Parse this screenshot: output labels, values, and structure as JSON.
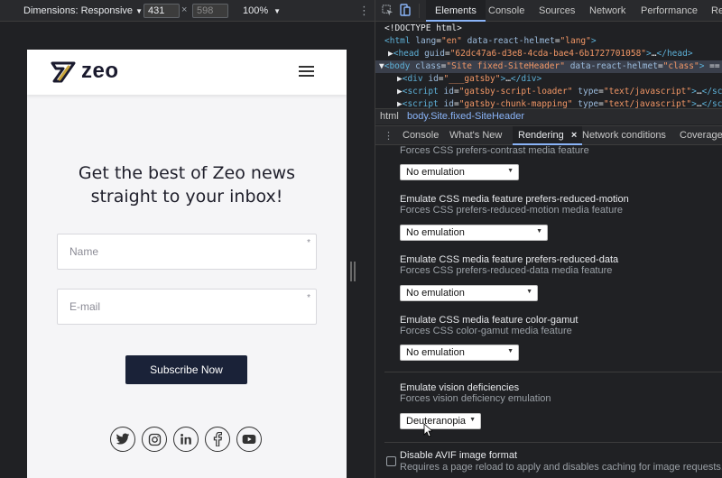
{
  "device_toolbar": {
    "dimensions_label": "Dimensions: Responsive",
    "width": "431",
    "height": "598",
    "times": "×",
    "zoom": "100%"
  },
  "phone": {
    "logo_text": "zeo",
    "headline": "Get the best of Zeo news straight to your inbox!",
    "name_placeholder": "Name",
    "email_placeholder": "E-mail",
    "required_mark": "*",
    "subscribe_label": "Subscribe Now",
    "social_icons": [
      "twitter-icon",
      "instagram-icon",
      "linkedin-icon",
      "facebook-icon",
      "youtube-icon"
    ]
  },
  "devtools": {
    "tabs": [
      "Elements",
      "Console",
      "Sources",
      "Network",
      "Performance",
      "Re"
    ],
    "active_tab": "Elements",
    "code_lines": [
      {
        "parts": [
          [
            "plain",
            "<!DOCTYPE html>"
          ]
        ]
      },
      {
        "parts": [
          [
            "tag",
            "<html "
          ],
          [
            "attr",
            "lang"
          ],
          [
            "plain",
            "="
          ],
          [
            "val",
            "\"en\""
          ],
          [
            "plain",
            " "
          ],
          [
            "attr",
            "data-react-helmet"
          ],
          [
            "plain",
            "="
          ],
          [
            "val",
            "\"lang\""
          ],
          [
            "tag",
            ">"
          ]
        ]
      },
      {
        "parts": [
          [
            "plain",
            "▶"
          ],
          [
            "tag",
            "<head "
          ],
          [
            "attr",
            "guid"
          ],
          [
            "plain",
            "="
          ],
          [
            "val",
            "\"62dc47a6-d3e8-4cda-bae4-6b1727701058\""
          ],
          [
            "tag",
            ">"
          ],
          [
            "plain",
            "…"
          ],
          [
            "tag",
            "</head>"
          ]
        ]
      },
      {
        "parts": [
          [
            "plain",
            "▼"
          ],
          [
            "tag",
            "<body "
          ],
          [
            "attr",
            "class"
          ],
          [
            "plain",
            "="
          ],
          [
            "val",
            "\"Site fixed-SiteHeader\""
          ],
          [
            "plain",
            " "
          ],
          [
            "attr",
            "data-react-helmet"
          ],
          [
            "plain",
            "="
          ],
          [
            "val",
            "\"class\""
          ],
          [
            "tag",
            ">"
          ],
          [
            "plain",
            " == $"
          ]
        ]
      },
      {
        "parts": [
          [
            "plain",
            "▶"
          ],
          [
            "tag",
            "<div "
          ],
          [
            "attr",
            "id"
          ],
          [
            "plain",
            "="
          ],
          [
            "val",
            "\"___gatsby\""
          ],
          [
            "tag",
            ">"
          ],
          [
            "plain",
            "…"
          ],
          [
            "tag",
            "</div>"
          ]
        ]
      },
      {
        "parts": [
          [
            "plain",
            "▶"
          ],
          [
            "tag",
            "<script "
          ],
          [
            "attr",
            "id"
          ],
          [
            "plain",
            "="
          ],
          [
            "val",
            "\"gatsby-script-loader\""
          ],
          [
            "plain",
            " "
          ],
          [
            "attr",
            "type"
          ],
          [
            "plain",
            "="
          ],
          [
            "val",
            "\"text/javascript\""
          ],
          [
            "tag",
            ">"
          ],
          [
            "plain",
            "…"
          ],
          [
            "tag",
            "</scrip"
          ]
        ]
      },
      {
        "parts": [
          [
            "plain",
            "▶"
          ],
          [
            "tag",
            "<script "
          ],
          [
            "attr",
            "id"
          ],
          [
            "plain",
            "="
          ],
          [
            "val",
            "\"gatsby-chunk-mapping\""
          ],
          [
            "plain",
            " "
          ],
          [
            "attr",
            "type"
          ],
          [
            "plain",
            "="
          ],
          [
            "val",
            "\"text/javascript\""
          ],
          [
            "tag",
            ">"
          ],
          [
            "plain",
            "…"
          ],
          [
            "tag",
            "</scrip"
          ]
        ]
      }
    ],
    "breadcrumb": [
      "html",
      "body.Site.fixed-SiteHeader"
    ],
    "drawer_tabs": [
      "Console",
      "What's New",
      "Rendering",
      "Network conditions",
      "Coverage"
    ],
    "active_drawer_tab": "Rendering",
    "close_glyph": "×",
    "rendering": {
      "contrast_desc": "Forces CSS prefers-contrast media feature",
      "contrast_value": "No emulation",
      "motion_title": "Emulate CSS media feature prefers-reduced-motion",
      "motion_desc": "Forces CSS prefers-reduced-motion media feature",
      "motion_value": "No emulation",
      "data_title": "Emulate CSS media feature prefers-reduced-data",
      "data_desc": "Forces CSS prefers-reduced-data media feature",
      "data_value": "No emulation",
      "gamut_title": "Emulate CSS media feature color-gamut",
      "gamut_desc": "Forces CSS color-gamut media feature",
      "gamut_value": "No emulation",
      "vision_title": "Emulate vision deficiencies",
      "vision_desc": "Forces vision deficiency emulation",
      "vision_value": "Deuteranopia",
      "avif_title": "Disable AVIF image format",
      "avif_desc": "Requires a page reload to apply and disables caching for image requests."
    }
  },
  "colors": {
    "brand_navy": "#1a2238",
    "logo_accent": "#c8a43a",
    "active_tab_underline": "#8ab4f8"
  }
}
